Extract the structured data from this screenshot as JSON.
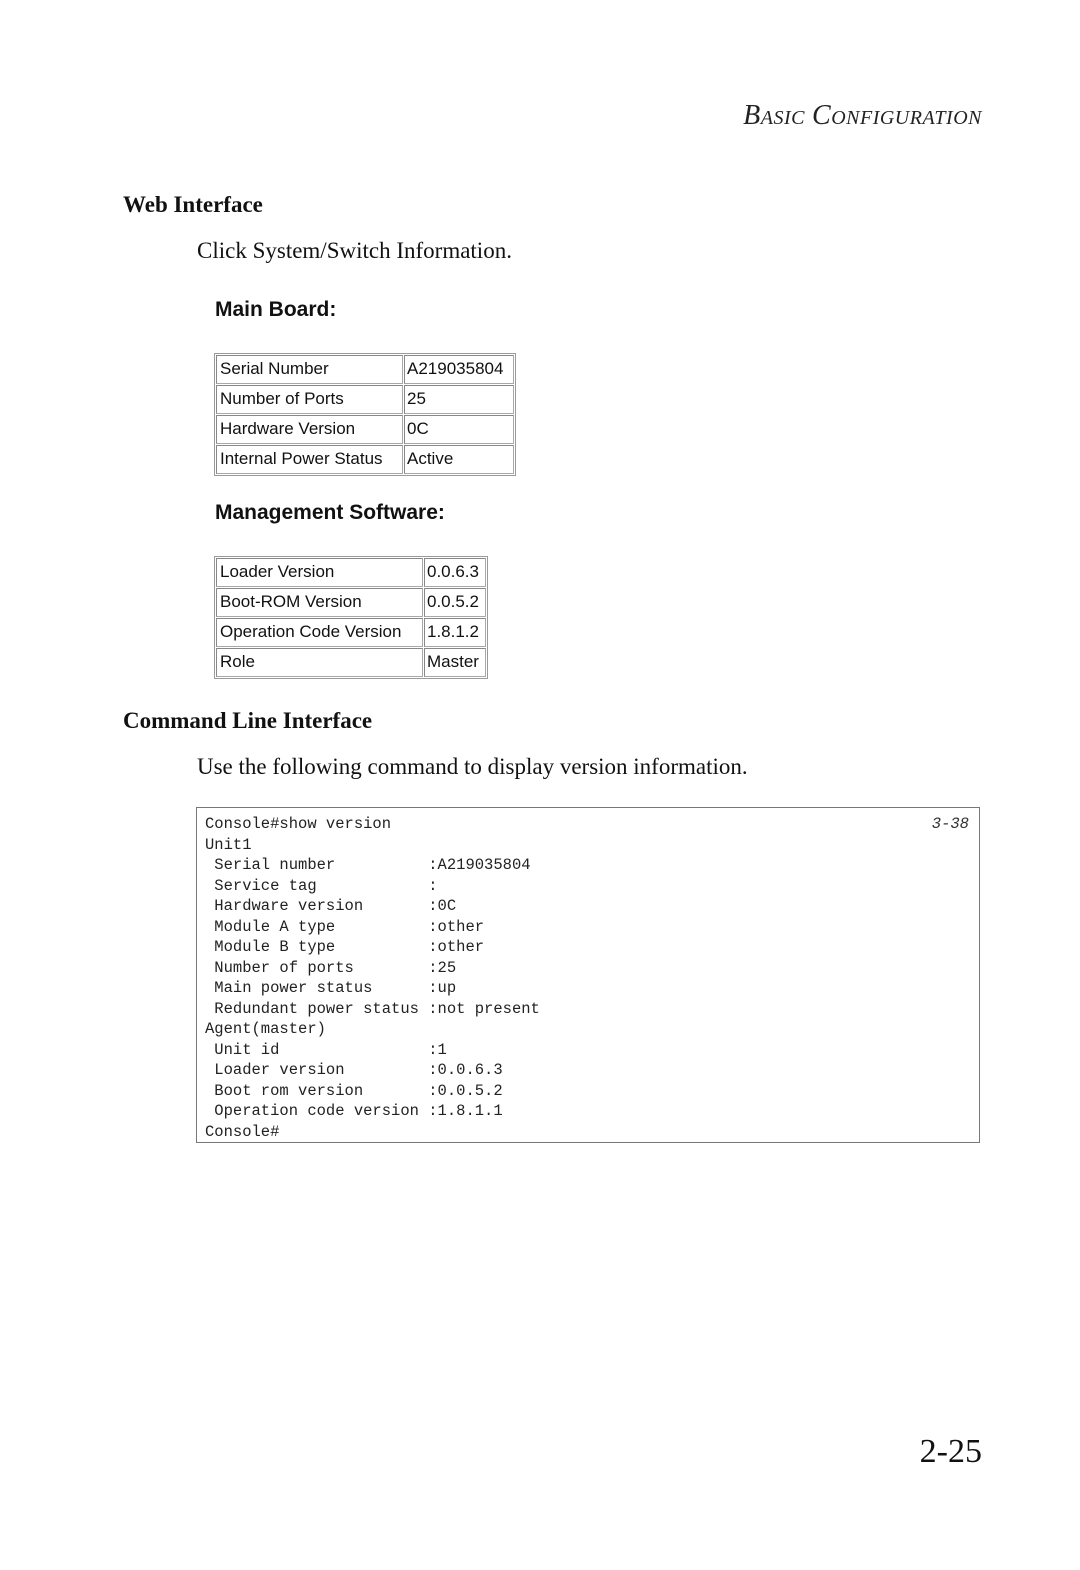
{
  "header": {
    "running_title_parts": [
      {
        "cap": "B",
        "rest": "ASIC"
      },
      {
        "cap": "C",
        "rest": "ONFIGURATION"
      }
    ]
  },
  "web_interface": {
    "heading": "Web Interface",
    "instruction": "Click System/Switch Information.",
    "main_board": {
      "title": "Main Board:",
      "rows": [
        {
          "label": "Serial Number",
          "value": "A219035804"
        },
        {
          "label": "Number of Ports",
          "value": "25"
        },
        {
          "label": "Hardware Version",
          "value": "0C"
        },
        {
          "label": "Internal Power Status",
          "value": "Active"
        }
      ]
    },
    "management_software": {
      "title": "Management Software:",
      "rows": [
        {
          "label": "Loader Version",
          "value": "0.0.6.3"
        },
        {
          "label": "Boot-ROM Version",
          "value": "0.0.5.2"
        },
        {
          "label": "Operation Code Version",
          "value": "1.8.1.2"
        },
        {
          "label": "Role",
          "value": "Master"
        }
      ]
    }
  },
  "cli": {
    "heading": "Command Line Interface",
    "instruction": "Use the following command to display version information.",
    "reference": "3-38",
    "lines": [
      "Console#show version",
      "Unit1",
      " Serial number          :A219035804",
      " Service tag            :",
      " Hardware version       :0C",
      " Module A type          :other",
      " Module B type          :other",
      " Number of ports        :25",
      " Main power status      :up",
      " Redundant power status :not present",
      "Agent(master)",
      " Unit id                :1",
      " Loader version         :0.0.6.3",
      " Boot rom version       :0.0.5.2",
      " Operation code version :1.8.1.1",
      "Console#"
    ]
  },
  "footer": {
    "page_number": "2-25"
  }
}
